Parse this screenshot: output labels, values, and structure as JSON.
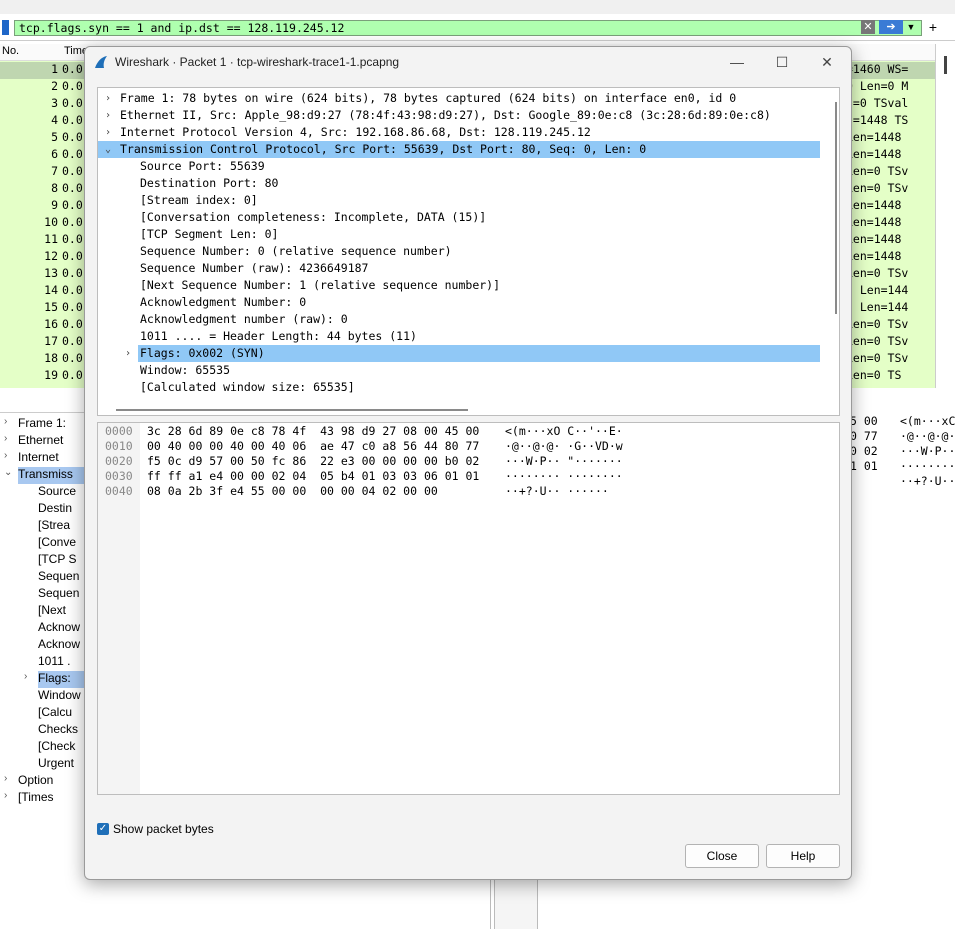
{
  "filter": {
    "value": "tcp.flags.syn == 1 and ip.dst == 128.119.245.12"
  },
  "packet_list": {
    "headers": [
      "No.",
      "Time"
    ],
    "rows": [
      {
        "no": "1",
        "time": "0.0",
        "info": "=1460 WS="
      },
      {
        "no": "2",
        "time": "0.0",
        "info": "0 Len=0 M"
      },
      {
        "no": "3",
        "time": "0.0",
        "info": "n=0 TSval"
      },
      {
        "no": "4",
        "time": "0.0",
        "info": "n=1448 TS"
      },
      {
        "no": "5",
        "time": "0.0",
        "info": "Len=1448"
      },
      {
        "no": "6",
        "time": "0.0",
        "info": "Len=1448"
      },
      {
        "no": "7",
        "time": "0.0",
        "info": "Len=0 TSv"
      },
      {
        "no": "8",
        "time": "0.0",
        "info": "Len=0 TSv"
      },
      {
        "no": "9",
        "time": "0.0",
        "info": "Len=1448"
      },
      {
        "no": "10",
        "time": "0.0",
        "info": "Len=1448"
      },
      {
        "no": "11",
        "time": "0.0",
        "info": "Len=1448"
      },
      {
        "no": "12",
        "time": "0.0",
        "info": "Len=1448"
      },
      {
        "no": "13",
        "time": "0.0",
        "info": "Len=0 TSv"
      },
      {
        "no": "14",
        "time": "0.0",
        "info": "2 Len=144"
      },
      {
        "no": "15",
        "time": "0.0",
        "info": "2 Len=144"
      },
      {
        "no": "16",
        "time": "0.0",
        "info": "Len=0 TSv"
      },
      {
        "no": "17",
        "time": "0.0",
        "info": "Len=0 TSv"
      },
      {
        "no": "18",
        "time": "0.0",
        "info": "Len=0 TSv"
      },
      {
        "no": "19",
        "time": "0.0",
        "info": "Len=0 TS"
      }
    ]
  },
  "bg_detail": {
    "rows": [
      {
        "text": "Frame 1:",
        "caret": "›"
      },
      {
        "text": "Ethernet",
        "caret": "›"
      },
      {
        "text": "Internet",
        "caret": "›"
      },
      {
        "text": "Transmiss",
        "caret": "⌄"
      },
      {
        "text": "Source",
        "caret": ""
      },
      {
        "text": "Destin",
        "caret": ""
      },
      {
        "text": "[Strea",
        "caret": ""
      },
      {
        "text": "[Conve",
        "caret": ""
      },
      {
        "text": "[TCP S",
        "caret": ""
      },
      {
        "text": "Sequen",
        "caret": ""
      },
      {
        "text": "Sequen",
        "caret": ""
      },
      {
        "text": "[Next",
        "caret": ""
      },
      {
        "text": "Acknow",
        "caret": ""
      },
      {
        "text": "Acknow",
        "caret": ""
      },
      {
        "text": "1011 .",
        "caret": ""
      },
      {
        "text": "Flags:",
        "caret": "›"
      },
      {
        "text": "Window",
        "caret": ""
      },
      {
        "text": "[Calcu",
        "caret": ""
      },
      {
        "text": "Checks",
        "caret": ""
      },
      {
        "text": "[Check",
        "caret": ""
      },
      {
        "text": "Urgent",
        "caret": ""
      },
      {
        "text": "Option",
        "caret": "›"
      },
      {
        "text": "[Times",
        "caret": "›"
      }
    ]
  },
  "bg_bytes": {
    "hex": [
      "5 00",
      "0 77",
      "0 02",
      "1 01"
    ],
    "ascii": [
      "<(m···xC",
      "·@··@·@·",
      "···W·P··",
      "········",
      "··+?·U··"
    ]
  },
  "dialog": {
    "title": "Wireshark · Packet 1 · tcp-wireshark-trace1-1.pcapng",
    "tree": [
      {
        "caret": "›",
        "indent": 0,
        "text": "Frame 1: 78 bytes on wire (624 bits), 78 bytes captured (624 bits) on interface en0, id 0"
      },
      {
        "caret": "›",
        "indent": 0,
        "text": "Ethernet II, Src: Apple_98:d9:27 (78:4f:43:98:d9:27), Dst: Google_89:0e:c8 (3c:28:6d:89:0e:c8)"
      },
      {
        "caret": "›",
        "indent": 0,
        "text": "Internet Protocol Version 4, Src: 192.168.86.68, Dst: 128.119.245.12"
      },
      {
        "caret": "⌄",
        "indent": 0,
        "text": "Transmission Control Protocol, Src Port: 55639, Dst Port: 80, Seq: 0, Len: 0",
        "highlight": true
      },
      {
        "caret": "",
        "indent": 1,
        "text": "Source Port: 55639"
      },
      {
        "caret": "",
        "indent": 1,
        "text": "Destination Port: 80"
      },
      {
        "caret": "",
        "indent": 1,
        "text": "[Stream index: 0]"
      },
      {
        "caret": "",
        "indent": 1,
        "text": "[Conversation completeness: Incomplete, DATA (15)]"
      },
      {
        "caret": "",
        "indent": 1,
        "text": "[TCP Segment Len: 0]"
      },
      {
        "caret": "",
        "indent": 1,
        "text": "Sequence Number: 0    (relative sequence number)"
      },
      {
        "caret": "",
        "indent": 1,
        "text": "Sequence Number (raw): 4236649187"
      },
      {
        "caret": "",
        "indent": 1,
        "text": "[Next Sequence Number: 1    (relative sequence number)]"
      },
      {
        "caret": "",
        "indent": 1,
        "text": "Acknowledgment Number: 0"
      },
      {
        "caret": "",
        "indent": 1,
        "text": "Acknowledgment number (raw): 0"
      },
      {
        "caret": "",
        "indent": 1,
        "text": "1011 .... = Header Length: 44 bytes (11)"
      },
      {
        "caret": "›",
        "indent": 1,
        "text": "Flags: 0x002 (SYN)",
        "highlight": true
      },
      {
        "caret": "",
        "indent": 1,
        "text": "Window: 65535"
      },
      {
        "caret": "",
        "indent": 1,
        "text": "[Calculated window size: 65535]"
      }
    ],
    "hex_rows": [
      {
        "offset": "0000",
        "hex": "3c 28 6d 89 0e c8 78 4f  43 98 d9 27 08 00 45 00",
        "ascii": "<(m···xO C··'··E·"
      },
      {
        "offset": "0010",
        "hex": "00 40 00 00 40 00 40 06  ae 47 c0 a8 56 44 80 77",
        "ascii": "·@··@·@· ·G··VD·w"
      },
      {
        "offset": "0020",
        "hex": "f5 0c d9 57 00 50 fc 86  22 e3 00 00 00 00 b0 02",
        "ascii": "···W·P·· \"·······"
      },
      {
        "offset": "0030",
        "hex": "ff ff a1 e4 00 00 02 04  05 b4 01 03 03 06 01 01",
        "ascii": "········ ········"
      },
      {
        "offset": "0040",
        "hex": "08 0a 2b 3f e4 55 00 00  00 00 04 02 00 00",
        "ascii": "··+?·U·· ······"
      }
    ],
    "show_bytes_label": "Show packet bytes",
    "show_bytes_checked": true,
    "close_label": "Close",
    "help_label": "Help"
  }
}
